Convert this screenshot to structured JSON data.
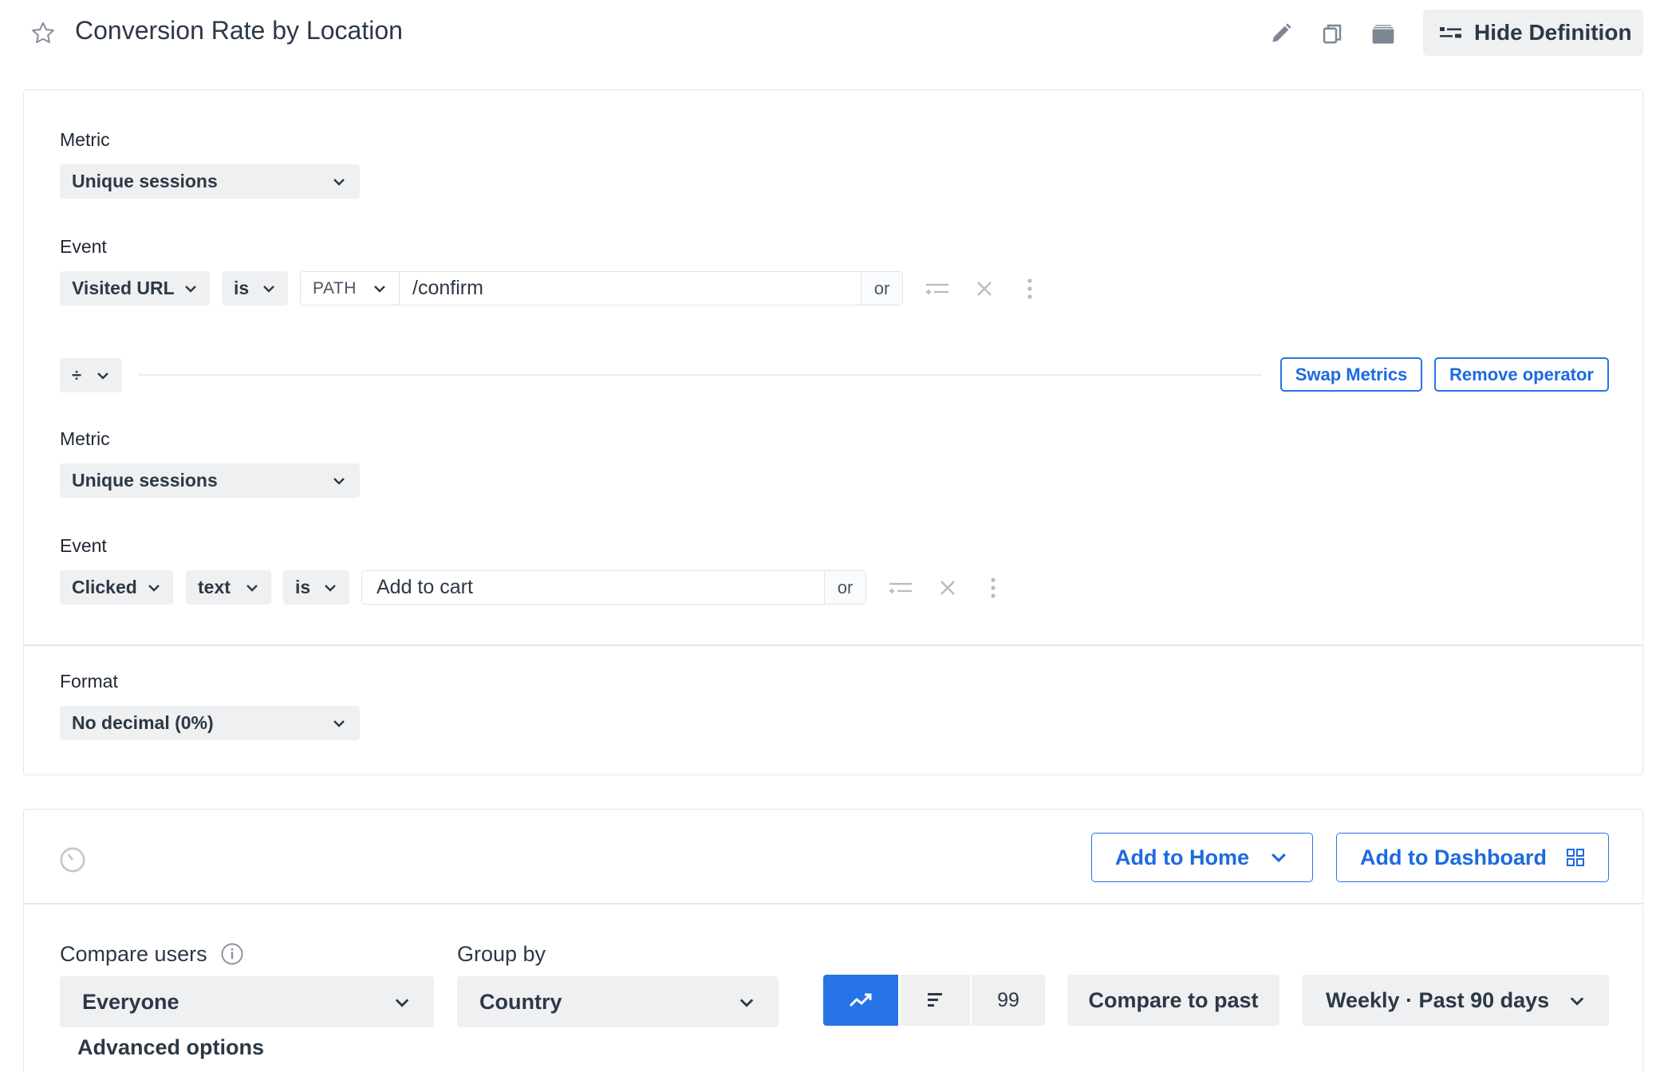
{
  "header": {
    "title": "Conversion Rate by Location",
    "hide_definition_label": "Hide Definition"
  },
  "numerator": {
    "metric_label": "Metric",
    "metric_value": "Unique sessions",
    "event_label": "Event",
    "event_type": "Visited URL",
    "operator": "is",
    "url_part": "PATH",
    "value": "/confirm",
    "or_label": "or"
  },
  "operator_row": {
    "symbol": "÷",
    "swap_label": "Swap Metrics",
    "remove_label": "Remove operator"
  },
  "denominator": {
    "metric_label": "Metric",
    "metric_value": "Unique sessions",
    "event_label": "Event",
    "event_type": "Clicked",
    "attribute": "text",
    "operator": "is",
    "value": "Add to cart",
    "or_label": "or"
  },
  "format": {
    "label": "Format",
    "value": "No decimal (0%)"
  },
  "actions": {
    "add_home_label": "Add to Home",
    "add_dashboard_label": "Add to Dashboard"
  },
  "controls": {
    "compare_users_label": "Compare users",
    "compare_users_value": "Everyone",
    "group_by_label": "Group by",
    "group_by_value": "Country",
    "count_value": "99",
    "compare_past_label": "Compare to past",
    "range_label": "Weekly · Past 90 days",
    "advanced_label": "Advanced options"
  },
  "colors": {
    "accent": "#2573e6",
    "chip_bg": "#eef0f2",
    "text": "#2d3846"
  },
  "icons": [
    "star-icon",
    "pencil-icon",
    "copy-icon",
    "folder-icon",
    "toggle-definition-icon",
    "chevron-down-icon",
    "refine-icon",
    "close-icon",
    "more-vertical-icon",
    "clock-icon",
    "dashboard-grid-icon",
    "info-icon",
    "line-chart-icon",
    "bar-chart-icon"
  ]
}
